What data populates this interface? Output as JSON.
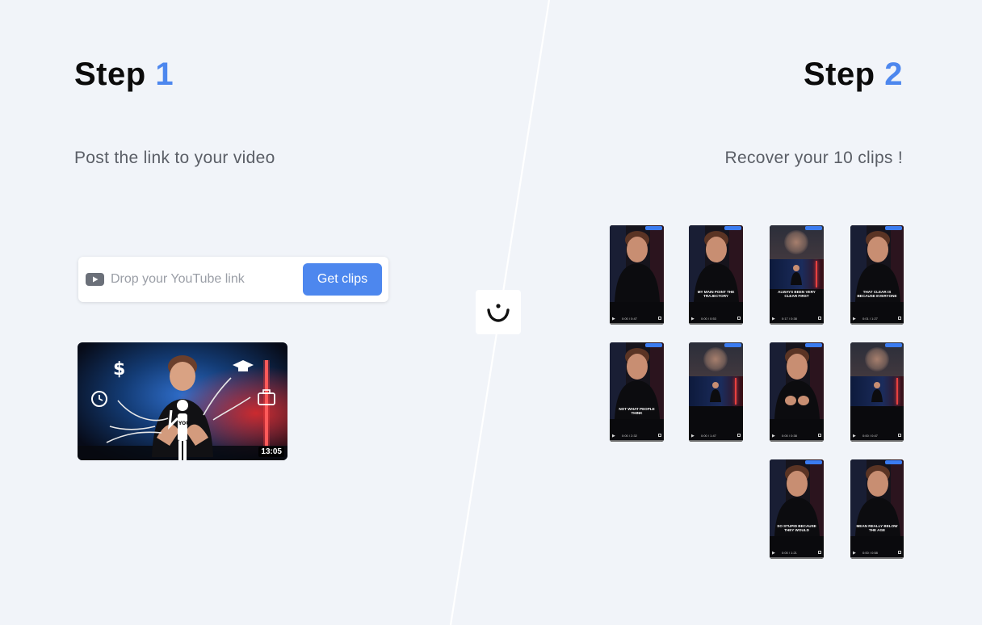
{
  "step1": {
    "label": "Step",
    "number": "1",
    "subtitle": "Post the link to your video"
  },
  "step2": {
    "label": "Step",
    "number": "2",
    "subtitle": "Recover your 10 clips !"
  },
  "link_form": {
    "icon": "youtube-icon",
    "placeholder": "Drop your YouTube link",
    "value": "",
    "button_label": "Get clips"
  },
  "source_video": {
    "duration": "13:05",
    "badge_text": "YOU"
  },
  "logo": {
    "icon": "smile-logo-icon"
  },
  "clips": [
    {
      "caption": "",
      "time": "0:00 / 0:47",
      "style": "face"
    },
    {
      "caption": "MY MAIN POINT THE TRAJECTORY",
      "time": "0:00 / 0:53",
      "style": "face"
    },
    {
      "caption": "ALWAYS BEEN VERY CLEAR FIRST",
      "time": "0:17 / 0:38",
      "style": "split"
    },
    {
      "caption": "THAT CLEAR IS BECAUSE EVERYONE",
      "time": "0:01 / 1:27",
      "style": "face"
    },
    {
      "caption": "NOT WHAT PEOPLE THINK",
      "time": "0:00 / 2:32",
      "style": "face"
    },
    {
      "caption": "",
      "time": "0:00 / 1:47",
      "style": "split"
    },
    {
      "caption": "",
      "time": "0:00 / 0:38",
      "style": "hands"
    },
    {
      "caption": "",
      "time": "0:00 / 0:47",
      "style": "split"
    },
    {
      "caption": "SO STUPID BECAUSE THEY WOULD",
      "time": "0:00 / 1:21",
      "style": "face"
    },
    {
      "caption": "MEAN REALLY BELOW THE AGE",
      "time": "0:00 / 0:58",
      "style": "face"
    }
  ],
  "colors": {
    "accent": "#4d87ee",
    "background": "#f1f4f9"
  }
}
